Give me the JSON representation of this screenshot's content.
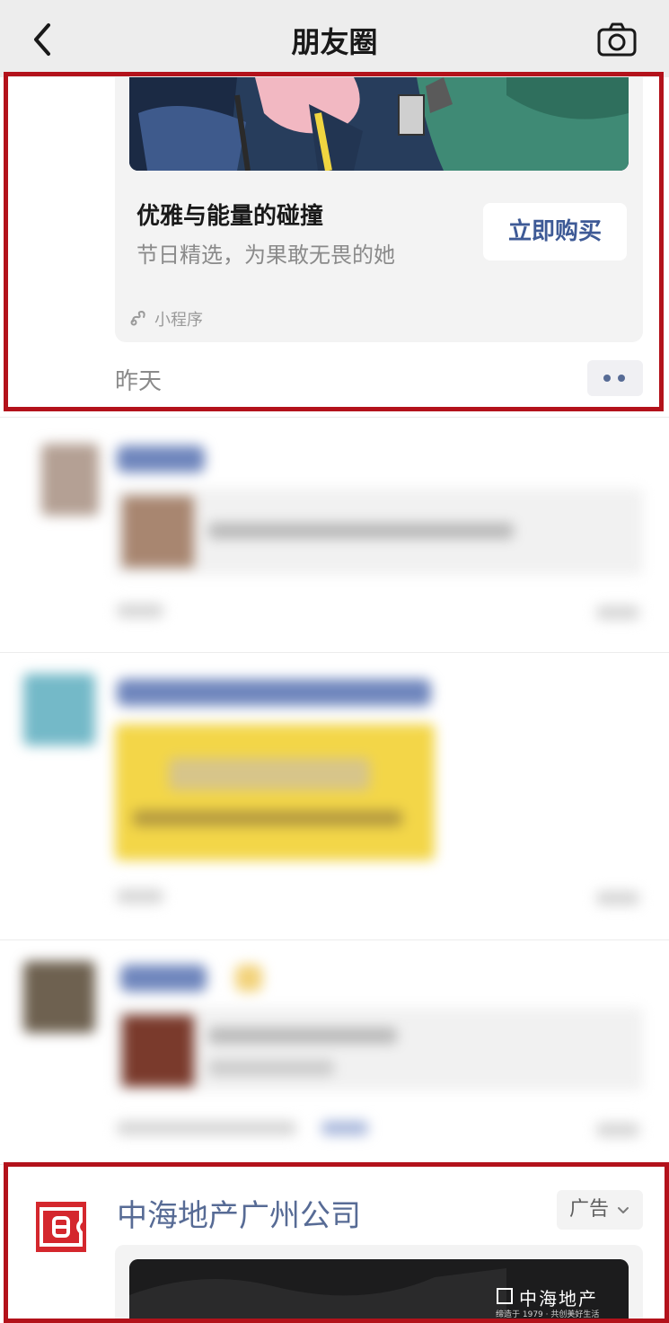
{
  "header": {
    "title": "朋友圈",
    "back_icon": "chevron-left-icon",
    "camera_icon": "camera-icon"
  },
  "highlight_color": "#b3121b",
  "top_ad": {
    "title": "优雅与能量的碰撞",
    "subtitle": "节日精选，为果敢无畏的她",
    "buy_label": "立即购买",
    "mini_program_label": "小程序",
    "timestamp": "昨天",
    "link_color": "#576b95"
  },
  "bottom_ad": {
    "brand_name": "中海地产广州公司",
    "ad_tag": "广告",
    "image_brand": "中海地产",
    "image_slogan": "缔造于 1979 · 共创美好生活"
  }
}
